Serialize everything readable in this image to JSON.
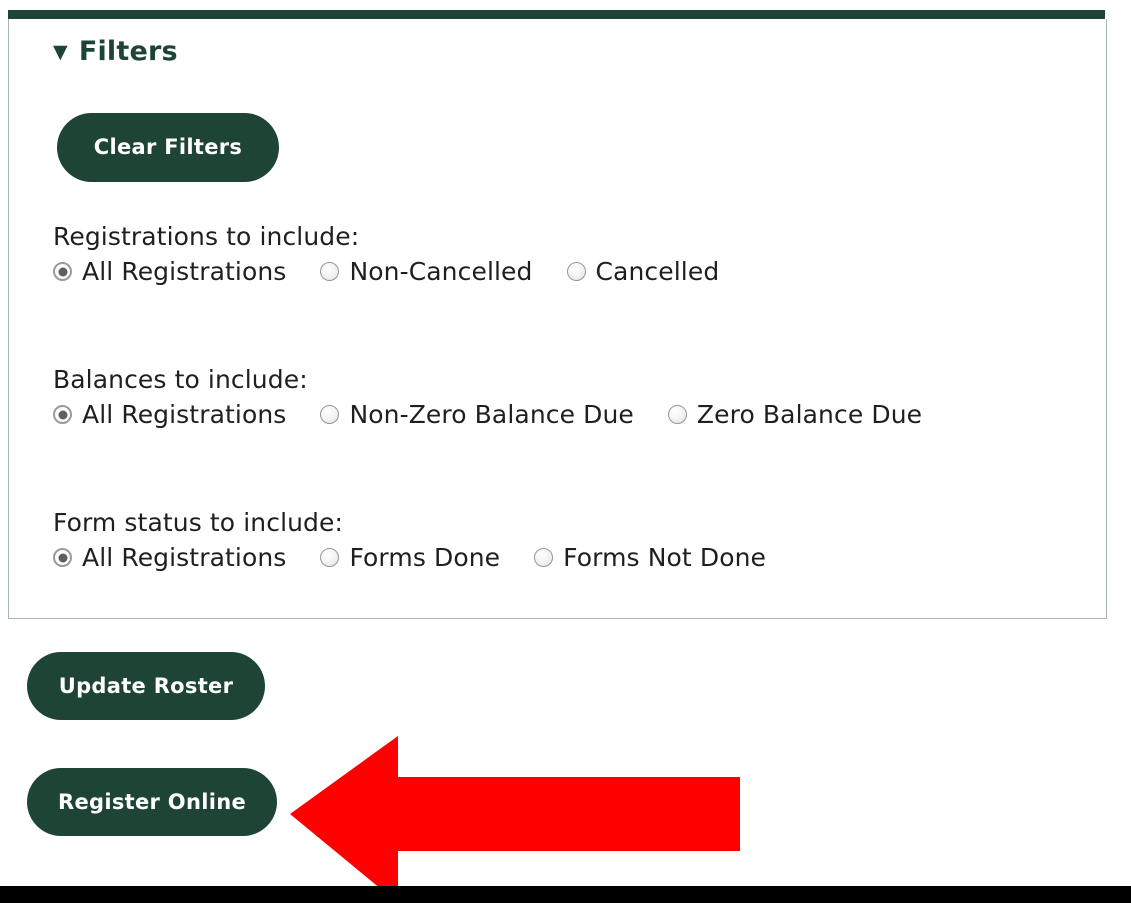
{
  "panel": {
    "header_title": "Filters",
    "header_toggle_icon": "▼",
    "clear_filters_label": "Clear Filters"
  },
  "filter_groups": [
    {
      "id": "registrations",
      "label": "Registrations to include:",
      "options": [
        {
          "label": "All Registrations",
          "selected": true
        },
        {
          "label": "Non-Cancelled",
          "selected": false
        },
        {
          "label": "Cancelled",
          "selected": false
        }
      ]
    },
    {
      "id": "balances",
      "label": "Balances to include:",
      "options": [
        {
          "label": "All Registrations",
          "selected": true
        },
        {
          "label": "Non-Zero Balance Due",
          "selected": false
        },
        {
          "label": "Zero Balance Due",
          "selected": false
        }
      ]
    },
    {
      "id": "formstatus",
      "label": "Form status to include:",
      "options": [
        {
          "label": "All Registrations",
          "selected": true
        },
        {
          "label": "Forms Done",
          "selected": false
        },
        {
          "label": "Forms Not Done",
          "selected": false
        }
      ]
    }
  ],
  "actions": {
    "update_roster_label": "Update Roster",
    "register_online_label": "Register Online"
  },
  "annotation": {
    "arrow_direction": "left",
    "arrow_color": "#FF0000"
  },
  "colors": {
    "brand_green": "#1D4435",
    "panel_border": "#AAB5B5",
    "text": "#1F1F1F",
    "bottom_bar": "#000000",
    "button_text": "#FFFFFF"
  }
}
